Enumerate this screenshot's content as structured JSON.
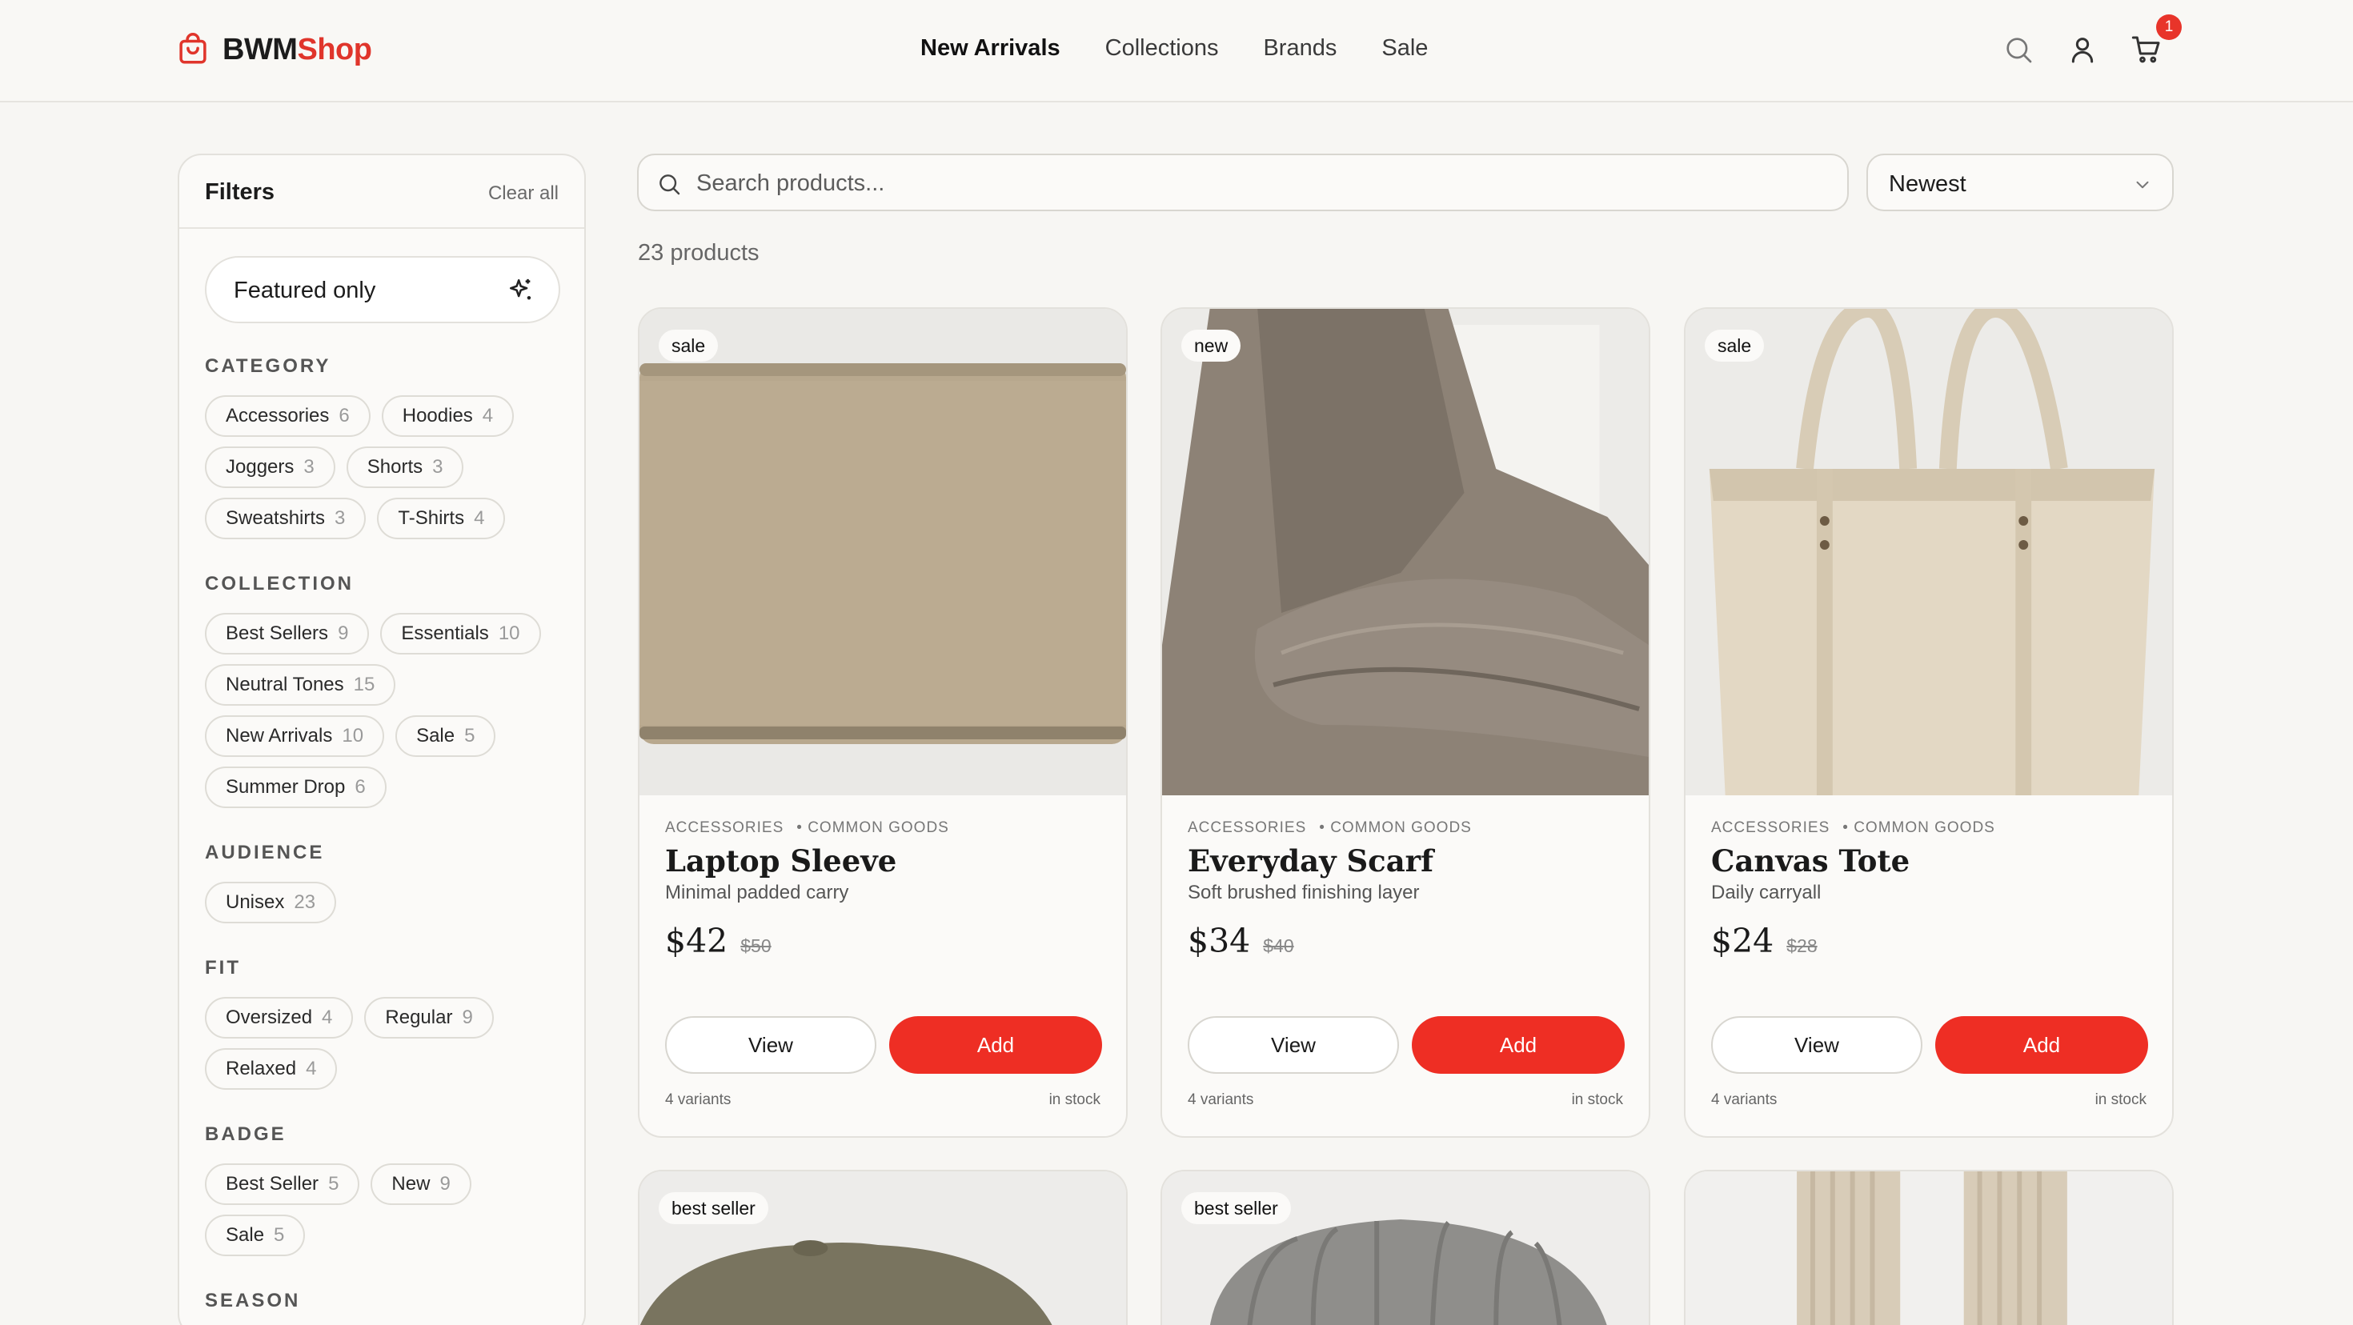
{
  "brand": {
    "name_a": "BWM",
    "name_b": "Shop"
  },
  "nav": [
    {
      "label": "New Arrivals",
      "active": true
    },
    {
      "label": "Collections"
    },
    {
      "label": "Brands"
    },
    {
      "label": "Sale"
    }
  ],
  "header_icons": [
    "search-icon",
    "user-icon",
    "cart-icon"
  ],
  "cart_count": "1",
  "filters": {
    "title": "Filters",
    "clear_label": "Clear all",
    "featured_label": "Featured only",
    "sections": [
      {
        "title": "CATEGORY",
        "chips": [
          {
            "label": "Accessories",
            "count": "6"
          },
          {
            "label": "Hoodies",
            "count": "4"
          },
          {
            "label": "Joggers",
            "count": "3"
          },
          {
            "label": "Shorts",
            "count": "3"
          },
          {
            "label": "Sweatshirts",
            "count": "3"
          },
          {
            "label": "T-Shirts",
            "count": "4"
          }
        ]
      },
      {
        "title": "COLLECTION",
        "chips": [
          {
            "label": "Best Sellers",
            "count": "9"
          },
          {
            "label": "Essentials",
            "count": "10"
          },
          {
            "label": "Neutral Tones",
            "count": "15"
          },
          {
            "label": "New Arrivals",
            "count": "10"
          },
          {
            "label": "Sale",
            "count": "5"
          },
          {
            "label": "Summer Drop",
            "count": "6"
          }
        ]
      },
      {
        "title": "AUDIENCE",
        "chips": [
          {
            "label": "Unisex",
            "count": "23"
          }
        ]
      },
      {
        "title": "FIT",
        "chips": [
          {
            "label": "Oversized",
            "count": "4"
          },
          {
            "label": "Regular",
            "count": "9"
          },
          {
            "label": "Relaxed",
            "count": "4"
          }
        ]
      },
      {
        "title": "BADGE",
        "chips": [
          {
            "label": "Best Seller",
            "count": "5"
          },
          {
            "label": "New",
            "count": "9"
          },
          {
            "label": "Sale",
            "count": "5"
          }
        ]
      },
      {
        "title": "SEASON",
        "chips": []
      }
    ]
  },
  "search": {
    "placeholder": "Search products..."
  },
  "sort": {
    "value": "Newest"
  },
  "results_count": "23 products",
  "buttons": {
    "view": "View",
    "add": "Add"
  },
  "products": [
    {
      "badge": "sale",
      "category": "ACCESSORIES",
      "brand": "• COMMON GOODS",
      "name": "Laptop Sleeve",
      "desc": "Minimal padded carry",
      "price": "$42",
      "old_price": "$50",
      "variants": "4 variants",
      "stock": "in stock"
    },
    {
      "badge": "new",
      "category": "ACCESSORIES",
      "brand": "• COMMON GOODS",
      "name": "Everyday Scarf",
      "desc": "Soft brushed finishing layer",
      "price": "$34",
      "old_price": "$40",
      "variants": "4 variants",
      "stock": "in stock"
    },
    {
      "badge": "sale",
      "category": "ACCESSORIES",
      "brand": "• COMMON GOODS",
      "name": "Canvas Tote",
      "desc": "Daily carryall",
      "price": "$24",
      "old_price": "$28",
      "variants": "4 variants",
      "stock": "in stock"
    },
    {
      "badge": "best seller"
    },
    {
      "badge": "best seller"
    },
    {
      "badge": ""
    }
  ],
  "colors": {
    "accent": "#ee2e24",
    "background": "#f7f6f3"
  }
}
